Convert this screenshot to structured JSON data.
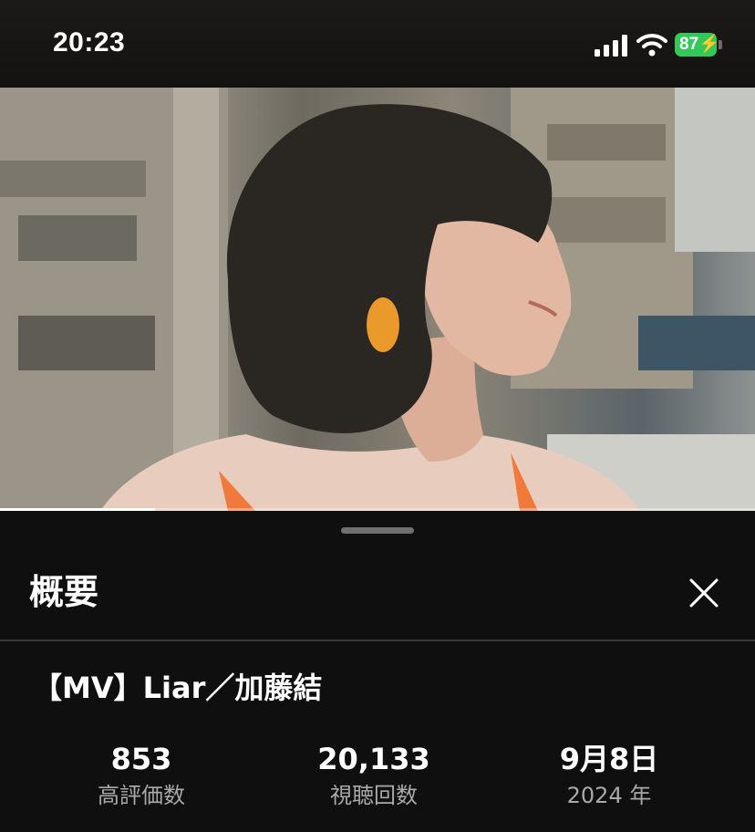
{
  "status_bar": {
    "time": "20:23",
    "battery": "87",
    "icons": [
      "signal-icon",
      "wifi-icon",
      "battery-charging-icon"
    ],
    "battery_color": "#34c759"
  },
  "player": {
    "progress_percent": 20.5
  },
  "panel": {
    "title": "概要",
    "close_icon": "close-icon"
  },
  "video": {
    "title": "【MV】Liar／加藤結",
    "stats": [
      {
        "value": "853",
        "label": "高評価数"
      },
      {
        "value": "20,133",
        "label": "視聴回数"
      },
      {
        "value": "9月8日",
        "label": "2024 年"
      }
    ]
  },
  "colors": {
    "background": "#0f0f0f",
    "divider": "#3a3a3a",
    "secondary_text": "#a9a9a9"
  }
}
